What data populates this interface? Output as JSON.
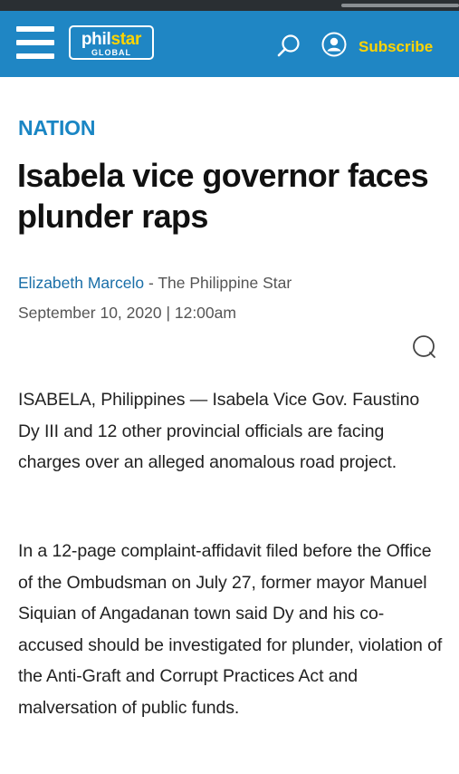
{
  "header": {
    "logo_main": "phil",
    "logo_accent": "star",
    "logo_sub": "GLOBAL",
    "subscribe_label": "Subscribe",
    "color_bar": "#1f86c4",
    "color_accent": "#ffd400"
  },
  "icons": {
    "menu": "hamburger-menu-icon",
    "search": "search-icon",
    "account": "user-account-icon",
    "comment": "comment-bubble-icon"
  },
  "article": {
    "section": "NATION",
    "title": "Isabela vice governor faces plunder raps",
    "author": "Elizabeth Marcelo",
    "source": " - The Philippine Star",
    "date": "September 10, 2020 | 12:00am",
    "paragraphs": [
      "ISABELA, Philippines — Isabela Vice Gov. Faustino Dy III and 12 other provincial officials are facing charges over an alleged anomalous road project.",
      "In a 12-page complaint-affidavit filed before the Office of the Ombudsman on July 27, former mayor Manuel Siquian of Angadanan town said Dy and his co-accused should be investigated for plunder, violation of the Anti-Graft and Corrupt Practices Act and malversation of public funds."
    ]
  }
}
